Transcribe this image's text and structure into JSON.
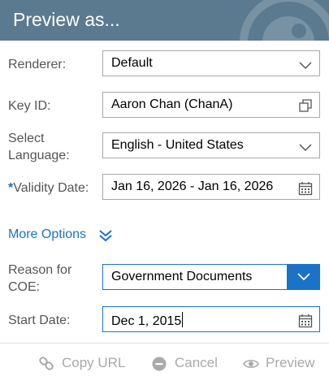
{
  "dialog": {
    "title": "Preview as..."
  },
  "form": {
    "renderer": {
      "label": "Renderer:",
      "value": "Default"
    },
    "key_id": {
      "label": "Key ID:",
      "value": "Aaron Chan (ChanA)"
    },
    "language": {
      "label_line1": "Select",
      "label_line2": "Language:",
      "value": "English - United States"
    },
    "validity": {
      "required_mark": "*",
      "label": "Validity Date:",
      "value": "Jan 16, 2026 - Jan 16, 2026"
    },
    "more_options": "More Options",
    "reason": {
      "label_line1": "Reason for",
      "label_line2": "COE:",
      "value": "Government Documents"
    },
    "start_date": {
      "label": "Start Date:",
      "value": "Dec 1, 2015"
    }
  },
  "footer": {
    "copy_url": "Copy URL",
    "cancel": "Cancel",
    "preview": "Preview"
  },
  "colors": {
    "header": "#5b7a90",
    "accent": "#1a73c9",
    "disabled_text": "#a9a9a9"
  }
}
